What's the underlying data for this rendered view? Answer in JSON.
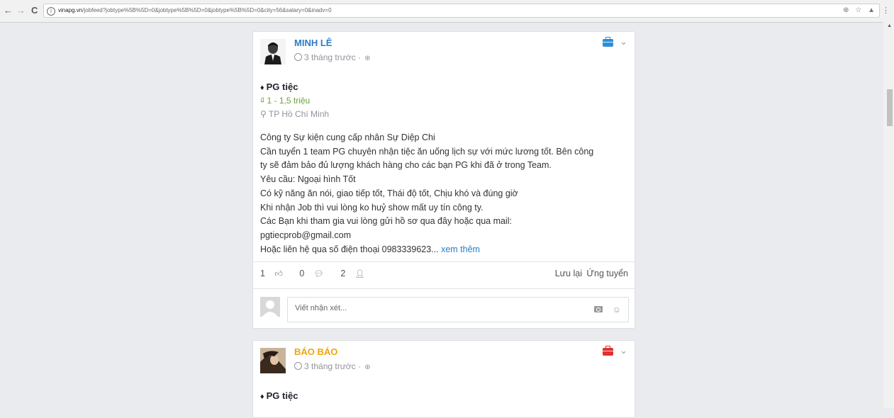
{
  "browser": {
    "url_domain": "vinapg.vn",
    "url_path": "/jobfeed?jobtype%5B%5D=0&jobtype%5B%5D=0&jobtype%5B%5D=0&city=56&salary=0&inadv=0"
  },
  "posts": [
    {
      "author": "MINH LÊ",
      "time": "3 tháng trước ·",
      "job_title": "PG tiệc",
      "salary": "1 - 1,5 triệu",
      "location": "TP Hồ Chí Minh",
      "description_lines": [
        "Công ty Sự kiện cung cấp nhân Sự Diệp Chi",
        "Cần tuyển 1 team PG chuyên nhận tiệc ăn uống lịch sự với mức lương tốt. Bên công",
        "ty sẽ đảm bảo đủ lượng khách hàng cho các bạn PG khi đã ở trong Team.",
        "Yêu cầu: Ngoại hình Tốt",
        "Có kỹ năng ăn nói, giao tiếp tốt, Thái độ tốt, Chịu khó và đúng giờ",
        "Khi nhận Job thì vui lòng ko huỷ show mất uy tín công ty.",
        "Các Bạn khi tham gia vui lòng gửi hồ sơ qua đây hoặc qua mail:",
        "pgtiecprob@gmail.com",
        "Hoặc liên hệ qua số điện thoại 0983339623..."
      ],
      "see_more": "xem thêm",
      "likes": "1",
      "comments": "0",
      "applicants": "2",
      "save_label": "Lưu lại",
      "apply_label": "Ứng tuyển",
      "comment_placeholder": "Viết nhận xét...",
      "badge_color": "#2e8fd6"
    },
    {
      "author": "BÁO BÁO",
      "time": "3 tháng trước ·",
      "job_title": "PG tiệc",
      "badge_color": "#e0322f"
    }
  ],
  "icons": {
    "back": "arrow-left-icon",
    "forward": "arrow-right-icon",
    "reload": "reload-icon",
    "info": "info-icon",
    "zoom": "zoom-icon",
    "star": "star-icon",
    "extension": "extension-icon",
    "menu": "more-vert-icon",
    "clock": "clock-icon",
    "globe": "globe-icon",
    "briefcase": "briefcase-icon",
    "chevron": "chevron-down-icon",
    "tie": "tie-icon",
    "money": "dong-icon",
    "pin": "map-pin-icon",
    "like": "thumbs-up-icon",
    "comment": "comment-icon",
    "user": "user-icon",
    "camera": "camera-icon",
    "smile": "smile-icon"
  }
}
